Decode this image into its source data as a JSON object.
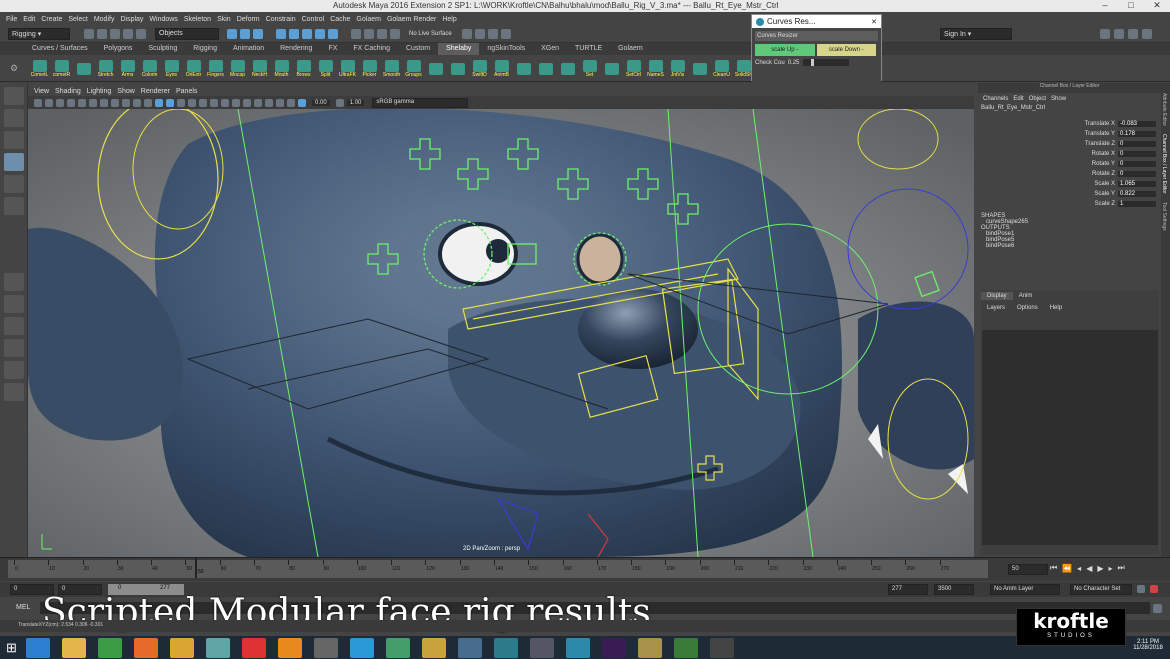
{
  "window": {
    "title": "Autodesk Maya 2016 Extension 2 SP1: L:\\WORK\\Kroftle\\CN\\Balhu\\bhalu\\mod\\Ballu_Rig_V_3.ma* --- Ballu_Rt_Eye_Mstr_Ctrl",
    "minimize": "–",
    "maximize": "□",
    "close": "✕"
  },
  "menubar": [
    "File",
    "Edit",
    "Create",
    "Select",
    "Modify",
    "Display",
    "Windows",
    "Skeleton",
    "Skin",
    "Deform",
    "Constrain",
    "Control",
    "Cache",
    "Golaem",
    "Golaem Render",
    "Help"
  ],
  "status": {
    "menuset": "Rigging",
    "objects": "Objects",
    "live_surface": "No Live Surface",
    "sign_in": "Sign In"
  },
  "shelf_tabs": {
    "items": [
      "Curves / Surfaces",
      "Polygons",
      "Sculpting",
      "Rigging",
      "Animation",
      "Rendering",
      "FX",
      "FX Caching",
      "Custom",
      "Shelaby",
      "ngSkinTools",
      "XGen",
      "TURTLE",
      "Golaem"
    ],
    "active_index": 9
  },
  "shelf_buttons": [
    "CometL",
    "cometR",
    "",
    "Stretch",
    "Arms",
    "Colorin",
    "Eyes",
    "OriExtr",
    "Fingers",
    "Mocap",
    "NeckH",
    "Mouth",
    "Brows",
    "Split",
    "UltraFK",
    "Picker",
    "Smooth",
    "Groups",
    "",
    "",
    "SwiftD",
    "AnimB",
    "",
    "",
    "",
    "Set",
    "",
    "SetCtrl",
    "NameS",
    "JntVis",
    "",
    "CleanU",
    "SolidSh",
    "Mcntlst",
    "",
    "",
    "CE"
  ],
  "curves_resizer": {
    "title": "Curves Res...",
    "header": "Curves Resizer",
    "scale_up": "scale Up -",
    "scale_down": "scale Down -",
    "check_label": "Check Cou",
    "check_value": "0.25"
  },
  "viewport": {
    "menu": [
      "View",
      "Shading",
      "Lighting",
      "Show",
      "Renderer",
      "Panels"
    ],
    "exposure": "0.00",
    "gamma": "1.00",
    "color_space": "sRGB gamma",
    "camera_label": "2D Pan/Zoom : persp"
  },
  "channel_box": {
    "header": "Channel Box / Layer Editor",
    "tabs": [
      "Channels",
      "Edit",
      "Object",
      "Show"
    ],
    "object": "Ballu_Rt_Eye_Mstr_Ctrl",
    "attrs": [
      {
        "name": "Translate X",
        "value": "-0.083"
      },
      {
        "name": "Translate Y",
        "value": "0.178"
      },
      {
        "name": "Translate Z",
        "value": "0"
      },
      {
        "name": "Rotate X",
        "value": "0"
      },
      {
        "name": "Rotate Y",
        "value": "0"
      },
      {
        "name": "Rotate Z",
        "value": "0"
      },
      {
        "name": "Scale X",
        "value": "1.065"
      },
      {
        "name": "Scale Y",
        "value": "0.822"
      },
      {
        "name": "Scale Z",
        "value": "1"
      }
    ],
    "shapes_label": "SHAPES",
    "shape": "curveShape265",
    "outputs_label": "OUTPUTS",
    "outputs": [
      "bindPose1",
      "bindPose5",
      "bindPose6"
    ],
    "side_tabs": [
      "Attribute Editor",
      "Channel Box / Layer Editor",
      "Tool Settings"
    ]
  },
  "layer_editor": {
    "tabs": [
      "Display",
      "Anim"
    ],
    "menu": [
      "Layers",
      "Options",
      "Help"
    ]
  },
  "timeline": {
    "ticks": [
      "0",
      "10",
      "20",
      "30",
      "40",
      "50",
      "60",
      "70",
      "80",
      "90",
      "100",
      "110",
      "120",
      "130",
      "140",
      "150",
      "160",
      "170",
      "180",
      "190",
      "200",
      "210",
      "220",
      "230",
      "240",
      "250",
      "260",
      "270"
    ],
    "current_frame": "50",
    "current_field": "50"
  },
  "range": {
    "start": "0",
    "start2": "0",
    "inner_start": "0",
    "inner_end": "277",
    "end": "277",
    "end2": "3500",
    "anim_layer": "No Anim Layer",
    "character_set": "No Character Set"
  },
  "mel": {
    "label": "MEL",
    "helpline": "TranslateXYZ(cm):   2.534   0.306   -0.301"
  },
  "caption": "Scripted Modular face rig results",
  "logo": {
    "brand": "kroftle",
    "sub": "STUDIOS"
  },
  "clock": {
    "time": "2:11 PM",
    "date": "11/28/2018"
  },
  "colors": {
    "body": "#3a4f66",
    "control_green": "#6cf26c",
    "control_yellow": "#e7e04a",
    "teal_accent": "#3a9a8a"
  }
}
